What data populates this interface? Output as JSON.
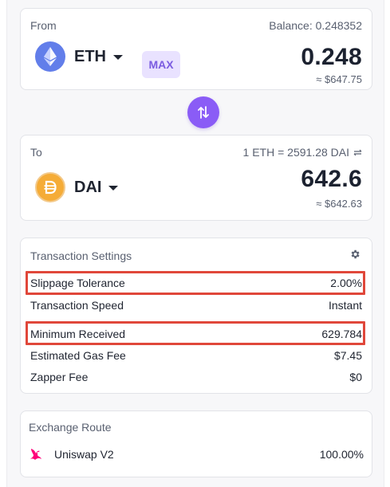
{
  "from": {
    "label": "From",
    "balance": "Balance: 0.248352",
    "token": "ETH",
    "max_label": "MAX",
    "amount": "0.248",
    "usd": "≈ $647.75",
    "icon": "ethereum-icon"
  },
  "to": {
    "label": "To",
    "rate": "1 ETH = 2591.28 DAI",
    "token": "DAI",
    "amount": "642.6",
    "usd": "≈ $642.63",
    "icon": "dai-icon"
  },
  "settings": {
    "title": "Transaction Settings",
    "rows": [
      {
        "label": "Slippage Tolerance",
        "value": "2.00%"
      },
      {
        "label": "Transaction Speed",
        "value": "Instant"
      },
      {
        "label": "Minimum Received",
        "value": "629.784"
      },
      {
        "label": "Estimated Gas Fee",
        "value": "$7.45"
      },
      {
        "label": "Zapper Fee",
        "value": "$0"
      }
    ]
  },
  "route": {
    "title": "Exchange Route",
    "dex": "Uniswap V2",
    "share": "100.00%"
  },
  "colors": {
    "accent": "#8a5cf6",
    "highlight": "#e0473a",
    "eth": "#627eea",
    "dai": "#f5ac37"
  }
}
